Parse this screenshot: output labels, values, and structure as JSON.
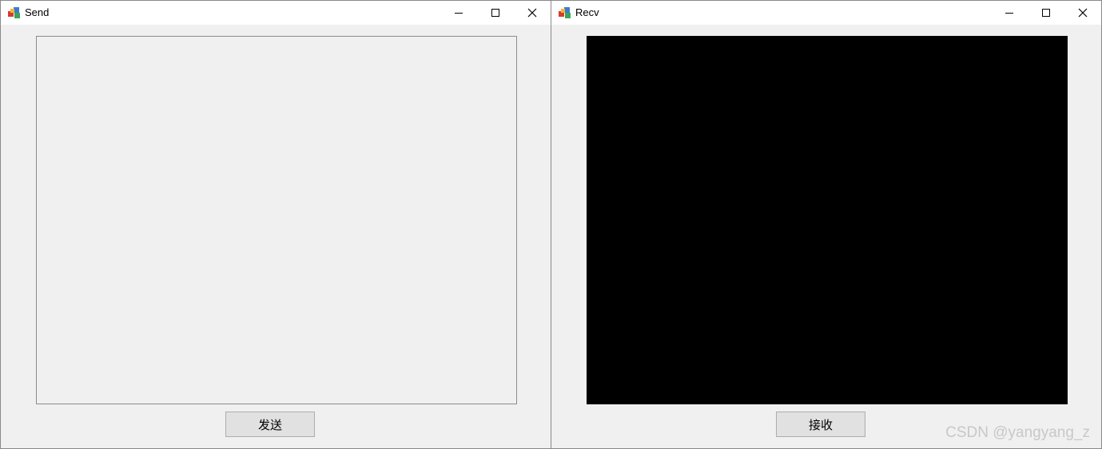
{
  "send_window": {
    "title": "Send",
    "icon": "app-cube-icon",
    "button_label": "发送"
  },
  "recv_window": {
    "title": "Recv",
    "icon": "app-cube-icon",
    "button_label": "接收",
    "display_color": "#000000"
  },
  "caption_buttons": [
    "minimize-icon",
    "maximize-icon",
    "close-icon"
  ],
  "watermark": "CSDN @yangyang_z"
}
